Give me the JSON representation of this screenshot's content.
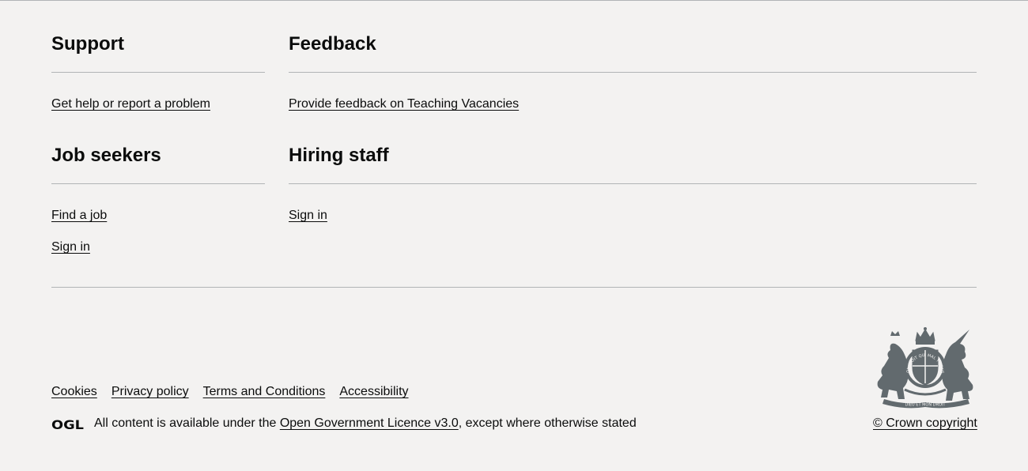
{
  "sections": {
    "support": {
      "title": "Support",
      "links": [
        "Get help or report a problem"
      ]
    },
    "feedback": {
      "title": "Feedback",
      "links": [
        "Provide feedback on Teaching Vacancies"
      ]
    },
    "job_seekers": {
      "title": "Job seekers",
      "links": [
        "Find a job",
        "Sign in"
      ]
    },
    "hiring_staff": {
      "title": "Hiring staff",
      "links": [
        "Sign in"
      ]
    }
  },
  "meta_links": [
    "Cookies",
    "Privacy policy",
    "Terms and Conditions",
    "Accessibility"
  ],
  "licence": {
    "logo": "OGL",
    "prefix": "All content is available under the ",
    "link": "Open Government Licence v3.0",
    "suffix": ", except where otherwise stated"
  },
  "crest": {
    "icon": "royal-coat-of-arms-icon",
    "motto_top": "HONI SOIT QUI MAL Y PENSE",
    "motto_bottom": "DIEU ET MON DROIT"
  },
  "copyright": "© Crown copyright",
  "colors": {
    "background": "#f3f2f1",
    "text": "#0b0c0c",
    "rule": "#b1b4b6",
    "crest": "#626a6e"
  }
}
